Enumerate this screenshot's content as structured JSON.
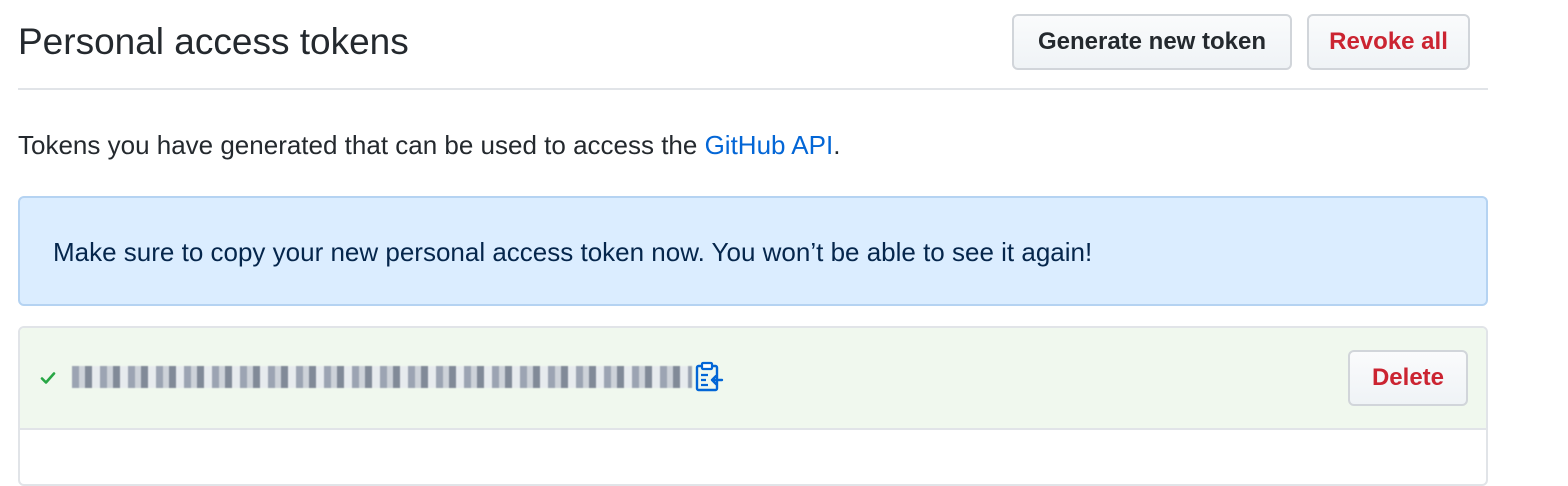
{
  "header": {
    "title": "Personal access tokens",
    "generate_label": "Generate new token",
    "revoke_all_label": "Revoke all"
  },
  "description": {
    "prefix": "Tokens you have generated that can be used to access the ",
    "link_text": "GitHub API",
    "suffix": "."
  },
  "flash": {
    "message": "Make sure to copy your new personal access token now. You won’t be able to see it again!"
  },
  "token": {
    "check_icon": "check-icon",
    "copy_icon": "clippy-icon",
    "delete_label": "Delete"
  },
  "colors": {
    "link": "#0366d6",
    "danger": "#cb2431",
    "flash_bg": "#dbedff",
    "token_bg": "#f0f8ee",
    "success": "#28a745"
  }
}
